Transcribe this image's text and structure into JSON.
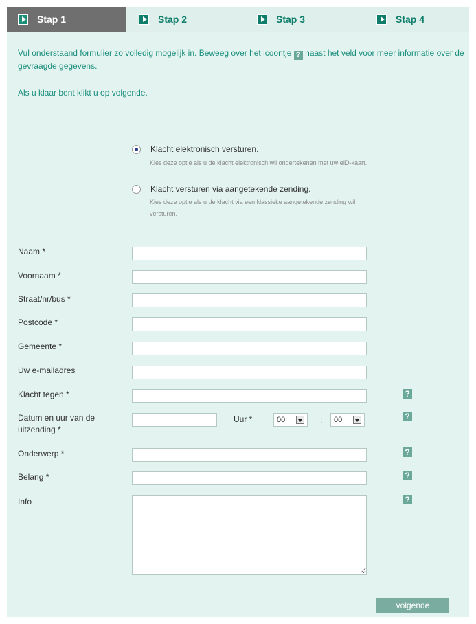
{
  "tabs": [
    {
      "label": "Stap 1",
      "active": true
    },
    {
      "label": "Stap 2",
      "active": false
    },
    {
      "label": "Stap 3",
      "active": false
    },
    {
      "label": "Stap 4",
      "active": false
    }
  ],
  "intro": {
    "part1": "Vul onderstaand formulier zo volledig mogelijk in. Beweeg over het icoontje",
    "icon_glyph": "?",
    "part2": "naast het veld voor meer informatie over de gevraagde gegevens.",
    "done": "Als u klaar bent klikt u op volgende."
  },
  "options": [
    {
      "label": "Klacht elektronisch versturen.",
      "help": "Kies deze optie als u de klacht elektronisch wil ondertekenen met uw eID-kaart.",
      "checked": true
    },
    {
      "label": "Klacht versturen via aangetekende zending.",
      "help": "Kies deze optie als u de klacht via een klassieke aangetekende zending wil versturen.",
      "checked": false
    }
  ],
  "fields": {
    "naam": "Naam *",
    "voornaam": "Voornaam *",
    "straat": "Straat/nr/bus *",
    "postcode": "Postcode *",
    "gemeente": "Gemeente *",
    "email": "Uw e-mailadres",
    "klacht_tegen": "Klacht tegen *",
    "datum_line1": "Datum en uur van de",
    "datum_line2": "uitzending *",
    "uur": "Uur *",
    "onderwerp": "Onderwerp *",
    "belang": "Belang *",
    "info": "Info"
  },
  "time": {
    "hour": "00",
    "separator": ":",
    "minute": "00"
  },
  "help_glyph": "?",
  "submit": "volgende",
  "colors": {
    "accent": "#0e7e6a",
    "panel": "#e3f3ef",
    "button": "#7aad9f",
    "active_tab": "#6f6f6f"
  }
}
